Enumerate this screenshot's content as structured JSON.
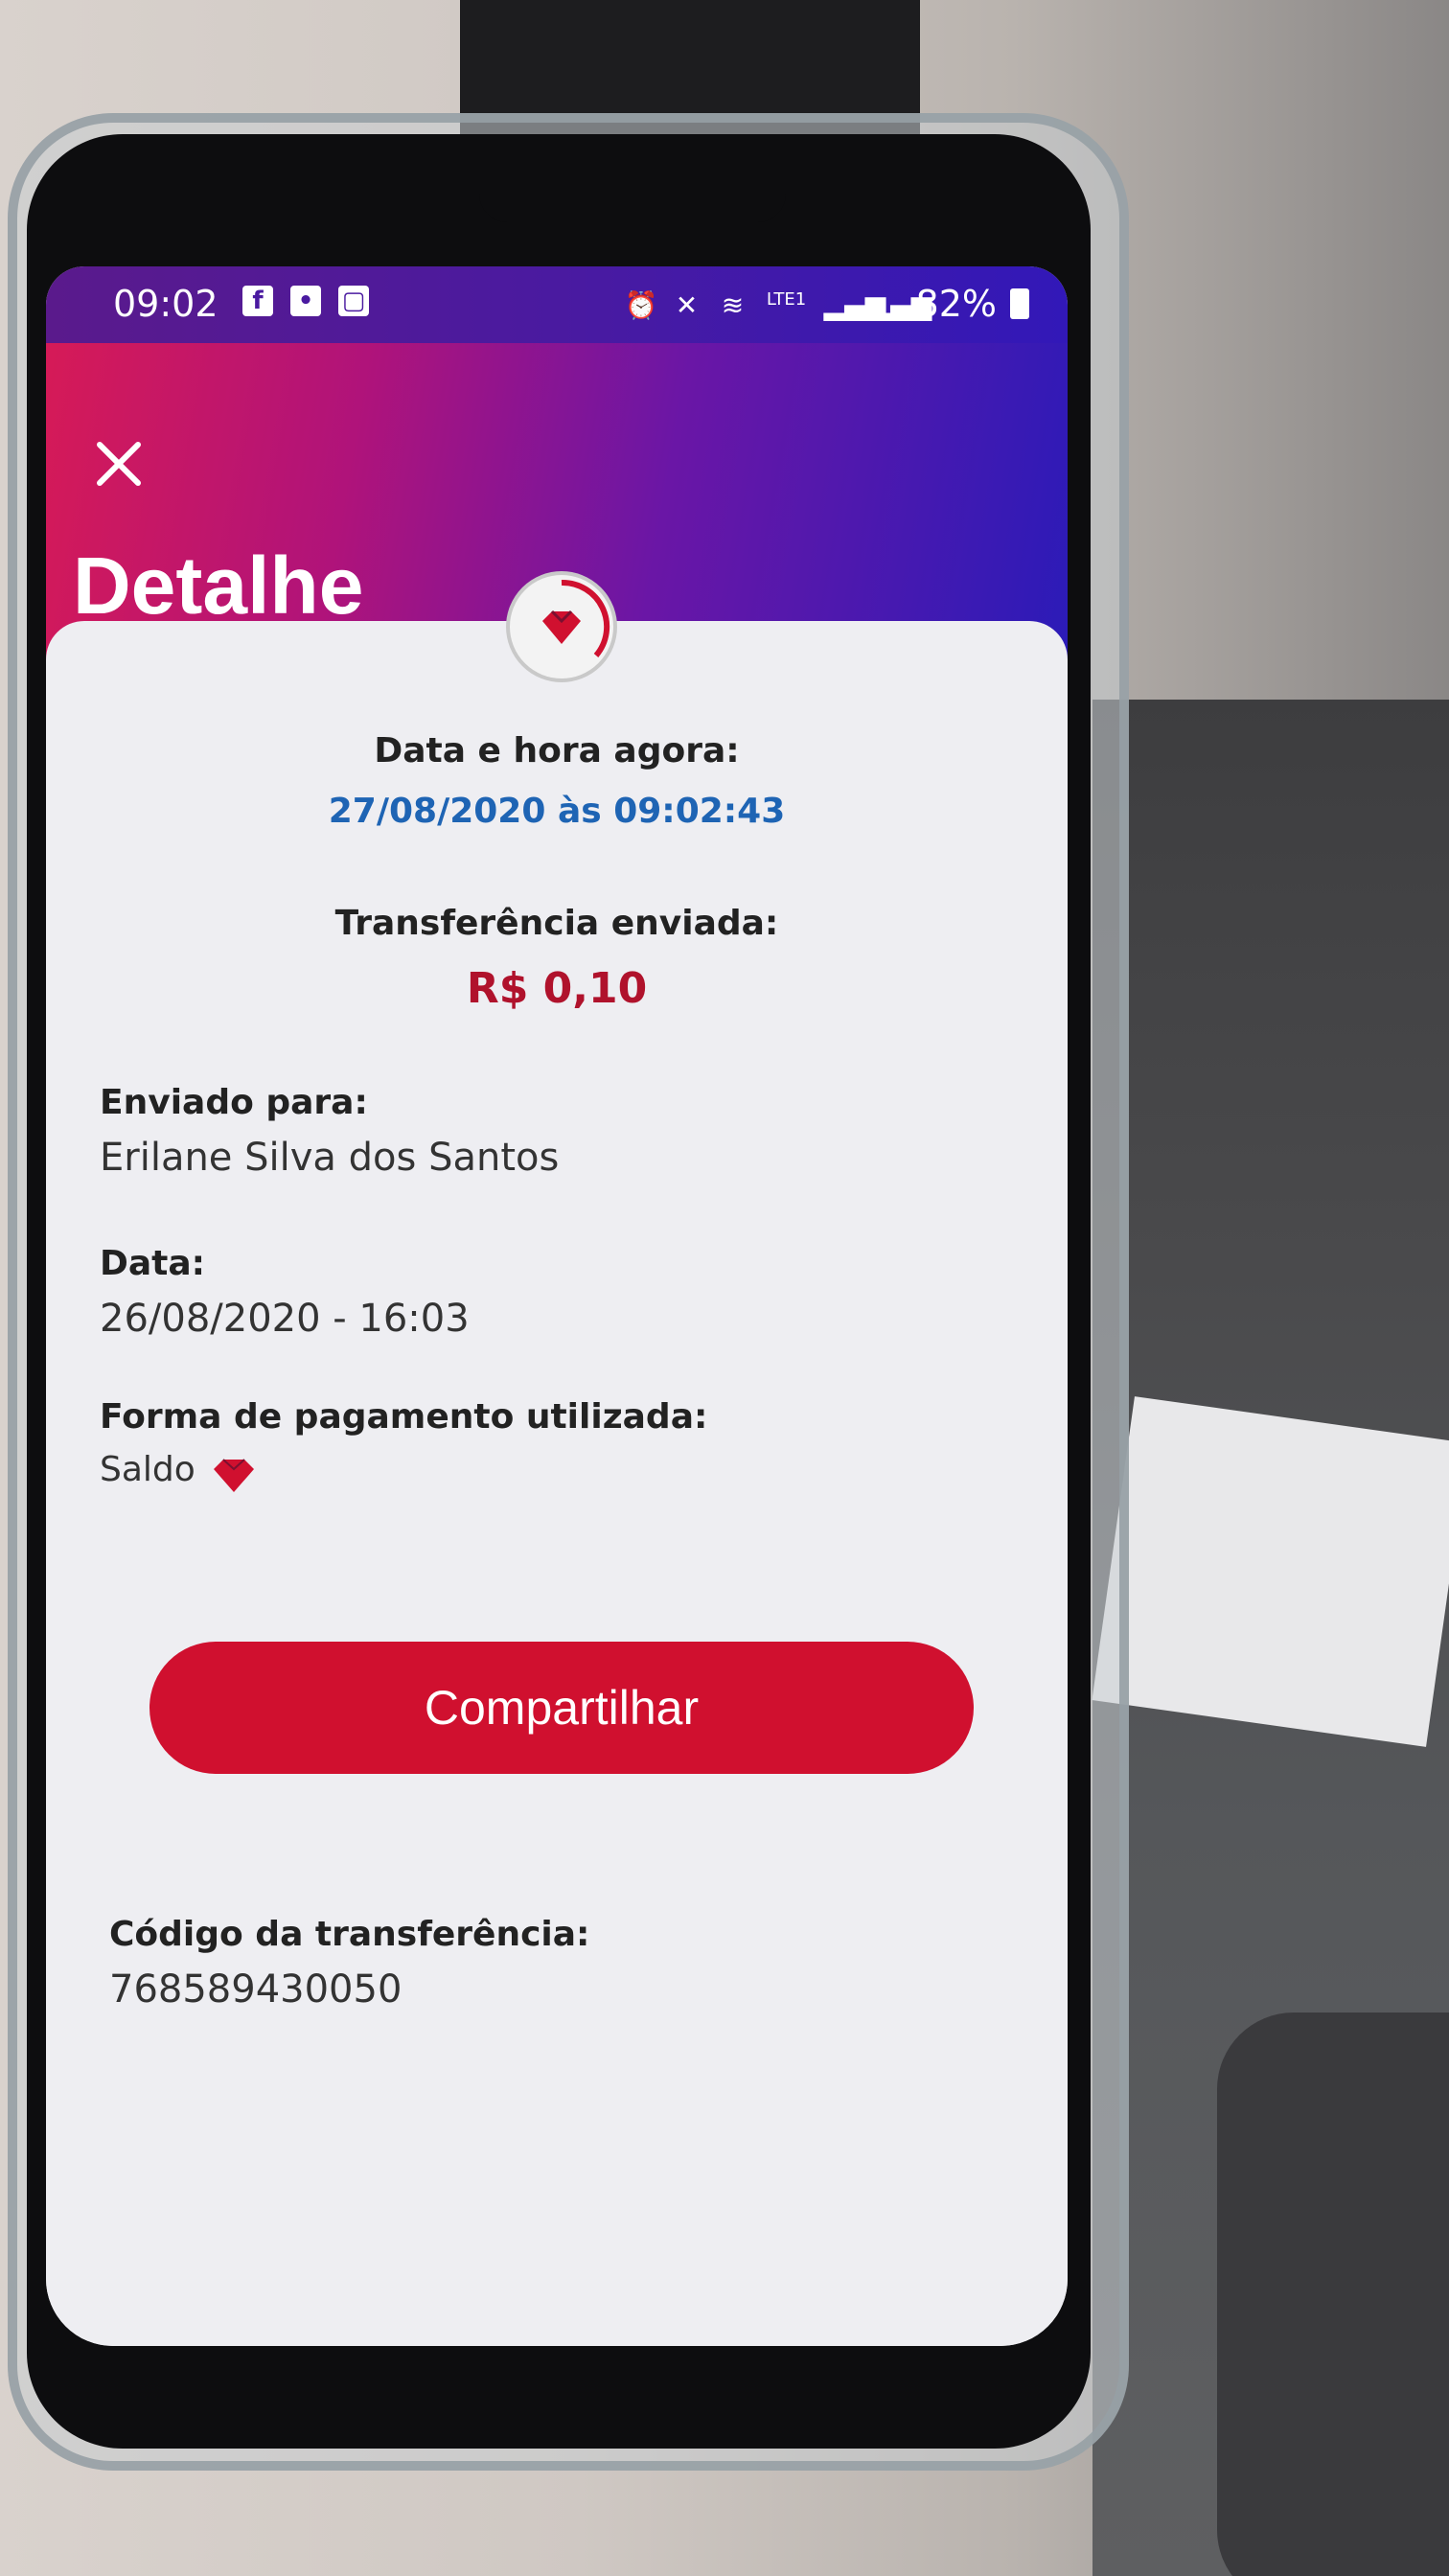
{
  "statusbar": {
    "time": "09:02",
    "battery": "82%",
    "network": "LTE1"
  },
  "header": {
    "title": "Detalhe"
  },
  "detail": {
    "now_label": "Data e hora agora:",
    "now_value": "27/08/2020 às 09:02:43",
    "transfer_label": "Transferência enviada:",
    "transfer_value": "R$ 0,10",
    "sent_to_label": "Enviado para:",
    "sent_to_value": "Erilane Silva dos Santos",
    "date_label": "Data:",
    "date_value": "26/08/2020 - 16:03",
    "payment_label": "Forma de pagamento utilizada:",
    "payment_value": "Saldo",
    "code_label": "Código da transferência:",
    "code_value": "768589430050"
  },
  "actions": {
    "share_label": "Compartilhar"
  },
  "colors": {
    "accent": "#d0102f",
    "amount": "#b0122c",
    "date_blue": "#1e64b4",
    "header_start": "#d61a57",
    "header_end": "#2b1bb8"
  },
  "icons": {
    "close": "close-icon",
    "logo": "heart-gem-icon",
    "payment": "heart-gem-icon"
  }
}
